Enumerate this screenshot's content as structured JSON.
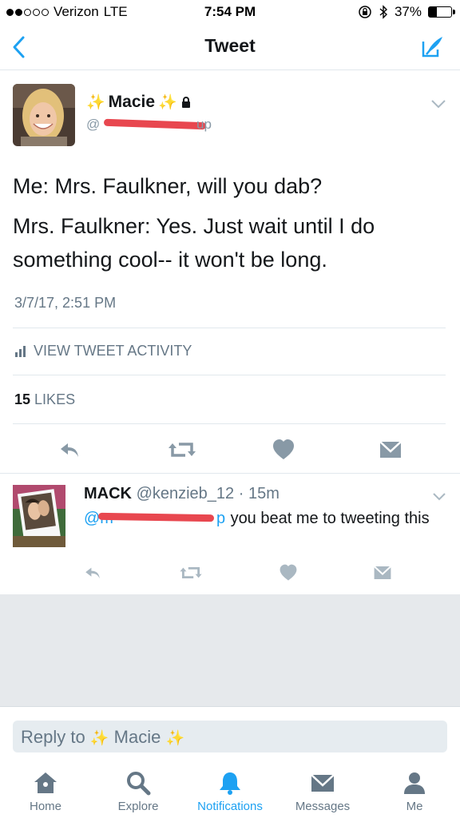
{
  "status_bar": {
    "carrier": "Verizon",
    "network": "LTE",
    "time": "7:54 PM",
    "battery": "37%",
    "battery_level": 0.37,
    "signal_bars_filled": 2,
    "signal_bars_total": 5
  },
  "nav": {
    "title": "Tweet",
    "back_icon": "chevron-left-icon",
    "compose_icon": "compose-icon"
  },
  "main_tweet": {
    "name": "Macie",
    "handle_prefix": "@",
    "handle_suffix": "up",
    "lines": [
      "Me: Mrs. Faulkner, will you dab?",
      "Mrs. Faulkner: Yes. Just wait until I do something cool-- it won't be long."
    ],
    "timestamp": "3/7/17, 2:51 PM",
    "activity_label": "VIEW TWEET ACTIVITY",
    "likes_count": "15",
    "likes_label": "LIKES"
  },
  "reply_tweet": {
    "name": "MACK",
    "handle": "@kenzieb_12",
    "separator": "·",
    "time": "15m",
    "mention_prefix": "@m",
    "mention_suffix": "p",
    "text": "you beat me to tweeting this"
  },
  "reply_bar": {
    "prefix": "Reply to",
    "name": "Macie"
  },
  "tabs": [
    {
      "label": "Home",
      "icon": "home-icon",
      "active": false
    },
    {
      "label": "Explore",
      "icon": "search-icon",
      "active": false
    },
    {
      "label": "Notifications",
      "icon": "bell-icon",
      "active": true
    },
    {
      "label": "Messages",
      "icon": "envelope-icon",
      "active": false
    },
    {
      "label": "Me",
      "icon": "person-icon",
      "active": false
    }
  ],
  "colors": {
    "accent": "#1da1f2",
    "icon_gray": "#8899a6",
    "redaction": "#e8474f",
    "sparkle": "#f2c94c"
  }
}
